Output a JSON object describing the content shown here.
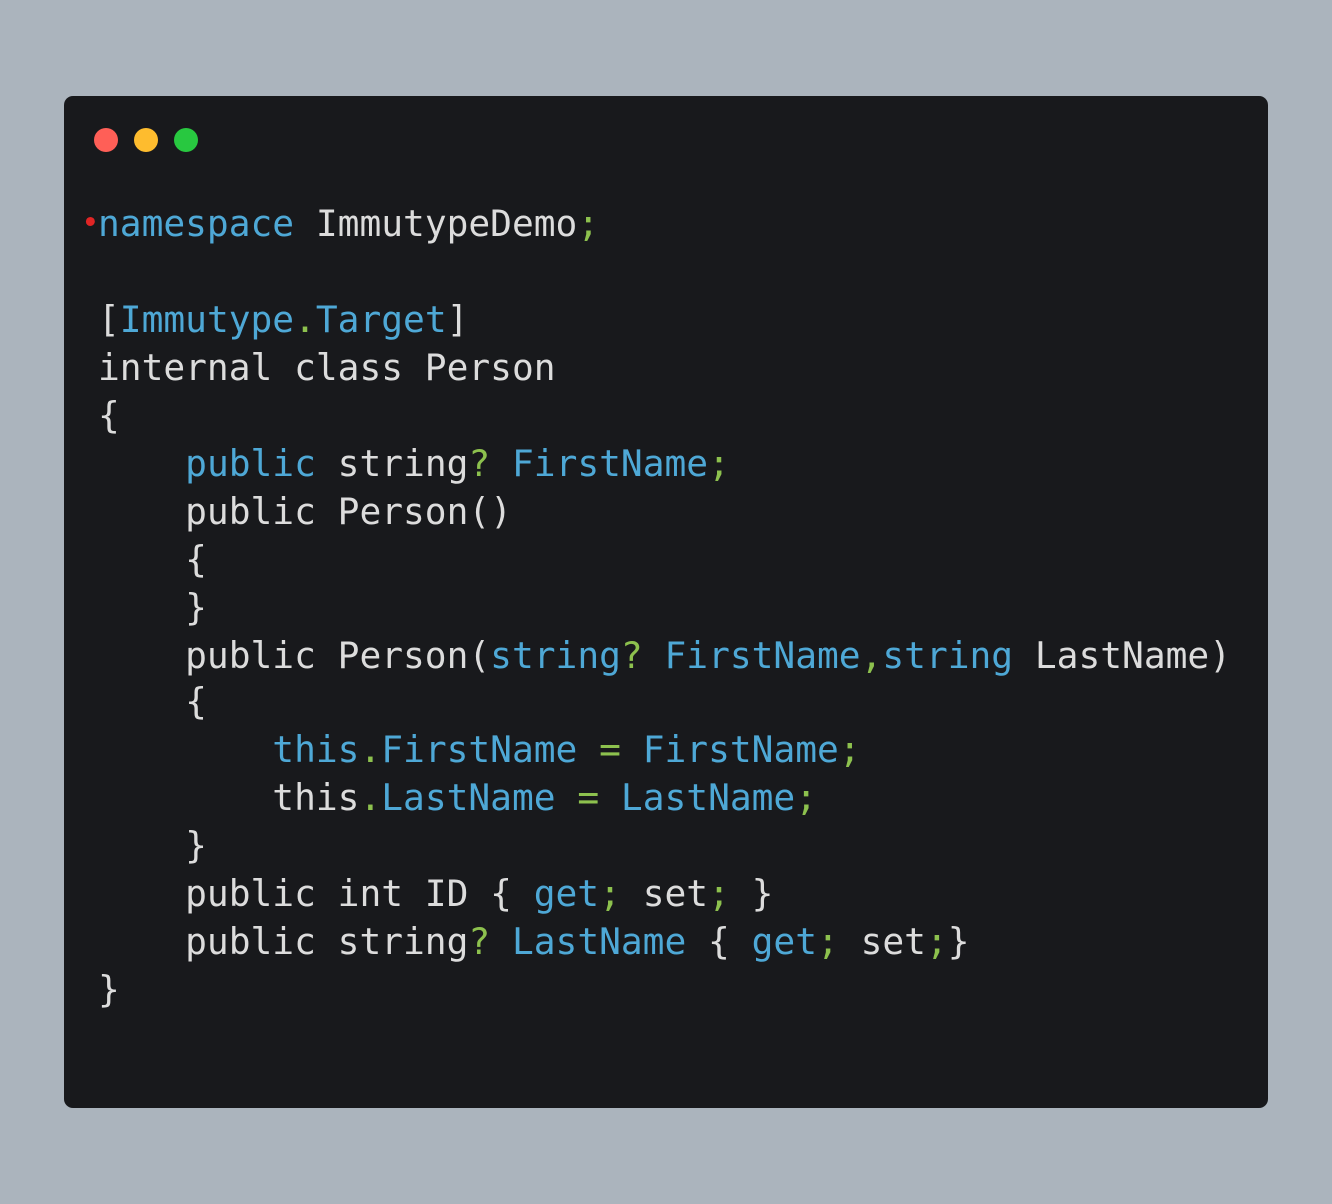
{
  "colors": {
    "page_background": "#abb4bd",
    "window_background": "#18191c",
    "window_controls": [
      "#ff5f57",
      "#febc2e",
      "#28c840"
    ],
    "token": {
      "plain": "#dcdcdc",
      "keyword": "#4ea8d6",
      "punct": "#8dc14e",
      "marker": "#e02525"
    }
  },
  "window": {
    "controls": [
      "close",
      "minimize",
      "maximize"
    ]
  },
  "code": {
    "language": "C#",
    "lines": [
      {
        "tokens": [
          {
            "t": "namespace",
            "c": "keyword"
          },
          {
            "t": " ImmutypeDemo",
            "c": "plain"
          },
          {
            "t": ";",
            "c": "punct"
          }
        ],
        "marker": "•"
      },
      {
        "tokens": []
      },
      {
        "tokens": [
          {
            "t": "[",
            "c": "plain"
          },
          {
            "t": "Immutype",
            "c": "keyword"
          },
          {
            "t": ".",
            "c": "punct"
          },
          {
            "t": "Target",
            "c": "keyword"
          },
          {
            "t": "]",
            "c": "plain"
          }
        ]
      },
      {
        "tokens": [
          {
            "t": "internal class Person",
            "c": "plain"
          }
        ]
      },
      {
        "tokens": [
          {
            "t": "{",
            "c": "plain"
          }
        ]
      },
      {
        "tokens": [
          {
            "t": "    ",
            "c": "plain"
          },
          {
            "t": "public",
            "c": "keyword"
          },
          {
            "t": " string",
            "c": "plain"
          },
          {
            "t": "?",
            "c": "punct"
          },
          {
            "t": " FirstName",
            "c": "keyword"
          },
          {
            "t": ";",
            "c": "punct"
          }
        ]
      },
      {
        "tokens": [
          {
            "t": "    public Person()",
            "c": "plain"
          }
        ]
      },
      {
        "tokens": [
          {
            "t": "    {",
            "c": "plain"
          }
        ]
      },
      {
        "tokens": [
          {
            "t": "    }",
            "c": "plain"
          }
        ]
      },
      {
        "tokens": [
          {
            "t": "    public Person(",
            "c": "plain"
          },
          {
            "t": "string",
            "c": "keyword"
          },
          {
            "t": "?",
            "c": "punct"
          },
          {
            "t": " FirstName",
            "c": "keyword"
          },
          {
            "t": ",",
            "c": "punct"
          },
          {
            "t": "string",
            "c": "keyword"
          },
          {
            "t": " LastName)",
            "c": "plain"
          }
        ]
      },
      {
        "tokens": [
          {
            "t": "    {",
            "c": "plain"
          }
        ]
      },
      {
        "tokens": [
          {
            "t": "        ",
            "c": "plain"
          },
          {
            "t": "this",
            "c": "keyword"
          },
          {
            "t": ".",
            "c": "punct"
          },
          {
            "t": "FirstName",
            "c": "keyword"
          },
          {
            "t": " ",
            "c": "plain"
          },
          {
            "t": "=",
            "c": "punct"
          },
          {
            "t": " FirstName",
            "c": "keyword"
          },
          {
            "t": ";",
            "c": "punct"
          }
        ]
      },
      {
        "tokens": [
          {
            "t": "        this",
            "c": "plain"
          },
          {
            "t": ".",
            "c": "punct"
          },
          {
            "t": "LastName",
            "c": "keyword"
          },
          {
            "t": " ",
            "c": "plain"
          },
          {
            "t": "=",
            "c": "punct"
          },
          {
            "t": " LastName",
            "c": "keyword"
          },
          {
            "t": ";",
            "c": "punct"
          }
        ]
      },
      {
        "tokens": [
          {
            "t": "    }",
            "c": "plain"
          }
        ]
      },
      {
        "tokens": [
          {
            "t": "    public int ID { ",
            "c": "plain"
          },
          {
            "t": "get",
            "c": "keyword"
          },
          {
            "t": ";",
            "c": "punct"
          },
          {
            "t": " set",
            "c": "plain"
          },
          {
            "t": ";",
            "c": "punct"
          },
          {
            "t": " }",
            "c": "plain"
          }
        ]
      },
      {
        "tokens": [
          {
            "t": "    public string",
            "c": "plain"
          },
          {
            "t": "?",
            "c": "punct"
          },
          {
            "t": " LastName",
            "c": "keyword"
          },
          {
            "t": " { ",
            "c": "plain"
          },
          {
            "t": "get",
            "c": "keyword"
          },
          {
            "t": ";",
            "c": "punct"
          },
          {
            "t": " set",
            "c": "plain"
          },
          {
            "t": ";",
            "c": "punct"
          },
          {
            "t": "}",
            "c": "plain"
          }
        ]
      },
      {
        "tokens": [
          {
            "t": "}",
            "c": "plain"
          }
        ]
      }
    ]
  }
}
